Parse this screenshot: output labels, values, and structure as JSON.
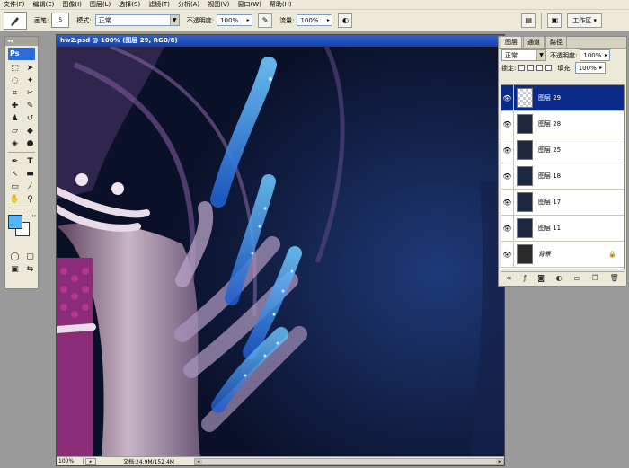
{
  "menu": [
    "文件(F)",
    "编辑(E)",
    "图像(I)",
    "图层(L)",
    "选择(S)",
    "滤镜(T)",
    "分析(A)",
    "视图(V)",
    "窗口(W)",
    "帮助(H)"
  ],
  "options": {
    "brush_label": "画笔:",
    "brush_size": "5",
    "mode_label": "模式:",
    "mode_value": "正常",
    "opacity_label": "不透明度:",
    "opacity_value": "100%",
    "flow_label": "流量:",
    "flow_value": "100%",
    "workspace_label": "工作区 ▾"
  },
  "toolbox": {
    "logo": "Ps"
  },
  "colors": {
    "foreground": "#4fb6ff",
    "background": "#ffffff"
  },
  "document": {
    "title": "hw2.psd @ 100% (图层 29, RGB/8)",
    "zoom": "100%",
    "doc_info": "文档:24.9M/152.4M"
  },
  "layers_panel": {
    "tabs": [
      "图层",
      "通道",
      "路径"
    ],
    "blend_mode": "正常",
    "opacity_label": "不透明度:",
    "opacity_value": "100%",
    "lock_label": "锁定:",
    "fill_label": "填充:",
    "fill_value": "100%",
    "layers": [
      {
        "name": "图层 29",
        "selected": true
      },
      {
        "name": "图层 28",
        "selected": false
      },
      {
        "name": "图层 25",
        "selected": false
      },
      {
        "name": "图层 18",
        "selected": false
      },
      {
        "name": "图层 17",
        "selected": false
      },
      {
        "name": "图层 11",
        "selected": false
      },
      {
        "name": "背景",
        "selected": false
      }
    ]
  }
}
